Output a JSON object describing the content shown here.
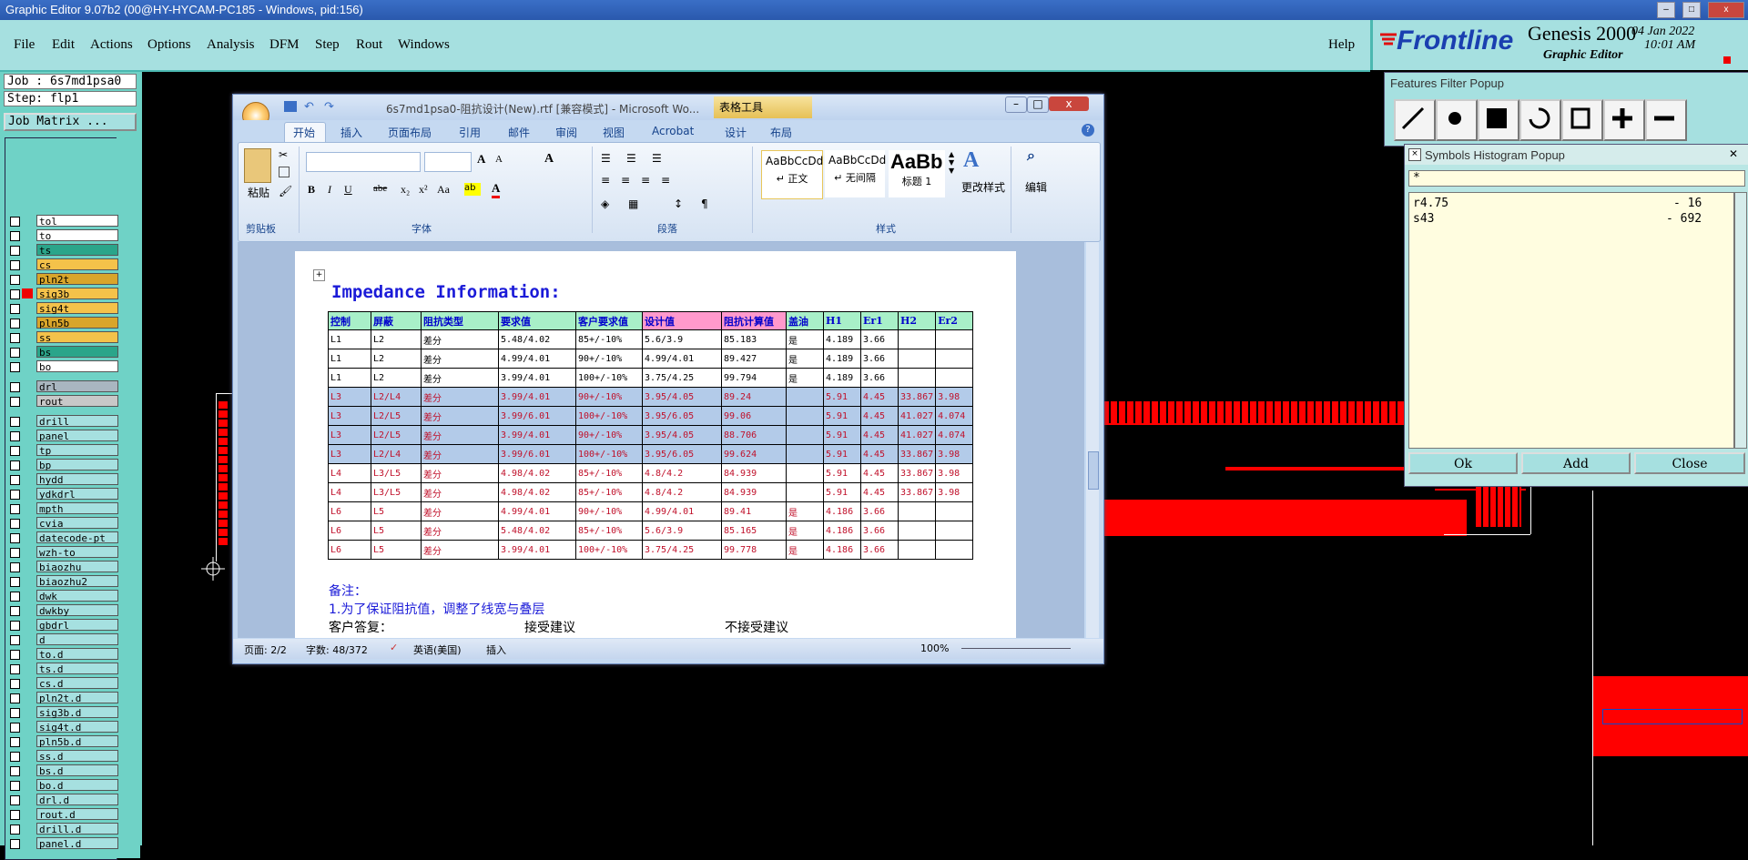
{
  "window": {
    "title": "Graphic Editor 9.07b2 (00@HY-HYCAM-PC185 - Windows, pid:156)"
  },
  "menu": {
    "items": [
      "File",
      "Edit",
      "Actions",
      "Options",
      "Analysis",
      "DFM",
      "Step",
      "Rout",
      "Windows"
    ],
    "help": "Help"
  },
  "brand": {
    "logo": "Frontline",
    "product": "Genesis 2000",
    "subtitle": "Graphic Editor",
    "date": "04 Jan 2022",
    "time": "10:01 AM"
  },
  "left": {
    "job": "Job : 6s7md1psa0",
    "step": "Step: flp1",
    "job_matrix": "Job Matrix ...",
    "layers": [
      {
        "name": "tol",
        "color": "#ffffff"
      },
      {
        "name": "to",
        "color": "#ffffff"
      },
      {
        "name": "ts",
        "color": "#2aa58a"
      },
      {
        "name": "cs",
        "color": "#f4c24a"
      },
      {
        "name": "pln2t",
        "color": "#d9a52a"
      },
      {
        "name": "sig3b",
        "color": "#f4c24a"
      },
      {
        "name": "sig4t",
        "color": "#f4c24a"
      },
      {
        "name": "pln5b",
        "color": "#d9a52a"
      },
      {
        "name": "ss",
        "color": "#f4c24a"
      },
      {
        "name": "bs",
        "color": "#2aa58a"
      },
      {
        "name": "bo",
        "color": "#ffffff"
      }
    ],
    "drill_layers": [
      {
        "name": "drl",
        "color": "#a9b6c0"
      },
      {
        "name": "rout",
        "color": "#c8c8c8"
      }
    ],
    "misc_layers": [
      "drill",
      "panel",
      "tp",
      "bp",
      "hydd",
      "ydkdrl",
      "mpth",
      "cvia",
      "datecode-pt",
      "wzh-to",
      "biaozhu",
      "biaozhu2",
      "dwk",
      "dwkby",
      "gbdrl",
      "d",
      "to.d",
      "ts.d",
      "cs.d",
      "pln2t.d",
      "sig3b.d",
      "sig4t.d",
      "pln5b.d",
      "ss.d",
      "bs.d",
      "bo.d",
      "drl.d",
      "rout.d",
      "drill.d",
      "panel.d"
    ]
  },
  "word": {
    "title": "6s7md1psa0-阻抗设计(New).rtf [兼容模式] - Microsoft Wo...",
    "context_tab": "表格工具",
    "tabs": [
      "开始",
      "插入",
      "页面布局",
      "引用",
      "邮件",
      "审阅",
      "视图",
      "Acrobat",
      "设计",
      "布局"
    ],
    "groups": [
      "剪贴板",
      "字体",
      "段落",
      "样式",
      "编辑"
    ],
    "paste": "粘贴",
    "styles": [
      {
        "preview": "AaBbCcDd",
        "name": "↵ 正文"
      },
      {
        "preview": "AaBbCcDd",
        "name": "↵ 无间隔"
      },
      {
        "preview": "AaBb",
        "name": "标题 1"
      }
    ],
    "change_styles": "更改样式",
    "edit": "编辑",
    "heading": "Impedance Information:",
    "table_headers": [
      "控制",
      "屏蔽",
      "阻抗类型",
      "要求值",
      "客户要求值",
      "设计值",
      "阻抗计算值",
      "盖油",
      "H1",
      "Er1",
      "H2",
      "Er2"
    ],
    "rows": [
      [
        "L1",
        "L2",
        "差分",
        "5.48/4.02",
        "85+/-10%",
        "5.6/3.9",
        "85.183",
        "是",
        "4.189",
        "3.66",
        "",
        ""
      ],
      [
        "L1",
        "L2",
        "差分",
        "4.99/4.01",
        "90+/-10%",
        "4.99/4.01",
        "89.427",
        "是",
        "4.189",
        "3.66",
        "",
        ""
      ],
      [
        "L1",
        "L2",
        "差分",
        "3.99/4.01",
        "100+/-10%",
        "3.75/4.25",
        "99.794",
        "是",
        "4.189",
        "3.66",
        "",
        ""
      ],
      [
        "L3",
        "L2/L4",
        "差分",
        "3.99/4.01",
        "90+/-10%",
        "3.95/4.05",
        "89.24",
        "",
        "5.91",
        "4.45",
        "33.867",
        "3.98"
      ],
      [
        "L3",
        "L2/L5",
        "差分",
        "3.99/6.01",
        "100+/-10%",
        "3.95/6.05",
        "99.06",
        "",
        "5.91",
        "4.45",
        "41.027",
        "4.074"
      ],
      [
        "L3",
        "L2/L5",
        "差分",
        "3.99/4.01",
        "90+/-10%",
        "3.95/4.05",
        "88.706",
        "",
        "5.91",
        "4.45",
        "41.027",
        "4.074"
      ],
      [
        "L3",
        "L2/L4",
        "差分",
        "3.99/6.01",
        "100+/-10%",
        "3.95/6.05",
        "99.624",
        "",
        "5.91",
        "4.45",
        "33.867",
        "3.98"
      ],
      [
        "L4",
        "L3/L5",
        "差分",
        "4.98/4.02",
        "85+/-10%",
        "4.8/4.2",
        "84.939",
        "",
        "5.91",
        "4.45",
        "33.867",
        "3.98"
      ],
      [
        "L4",
        "L3/L5",
        "差分",
        "4.98/4.02",
        "85+/-10%",
        "4.8/4.2",
        "84.939",
        "",
        "5.91",
        "4.45",
        "33.867",
        "3.98"
      ],
      [
        "L6",
        "L5",
        "差分",
        "4.99/4.01",
        "90+/-10%",
        "4.99/4.01",
        "89.41",
        "是",
        "4.186",
        "3.66",
        "",
        ""
      ],
      [
        "L6",
        "L5",
        "差分",
        "5.48/4.02",
        "85+/-10%",
        "5.6/3.9",
        "85.165",
        "是",
        "4.186",
        "3.66",
        "",
        ""
      ],
      [
        "L6",
        "L5",
        "差分",
        "3.99/4.01",
        "100+/-10%",
        "3.75/4.25",
        "99.778",
        "是",
        "4.186",
        "3.66",
        "",
        ""
      ]
    ],
    "note1": "备注：",
    "note2": "1.为了保证阻抗值，调整了线宽与叠层",
    "reply": "客户答复：",
    "accept": "接受建议",
    "reject": "不接受建议",
    "status": {
      "page": "页面: 2/2",
      "words": "字数: 48/372",
      "lang": "英语(美国)",
      "mode": "插入",
      "zoom": "100%"
    }
  },
  "features_popup": {
    "title": "Features Filter Popup"
  },
  "symbols_popup": {
    "title": "Symbols Histogram Popup",
    "filter": "*",
    "items": [
      {
        "name": "r4.75",
        "count": "- 16"
      },
      {
        "name": "s43",
        "count": "- 692"
      }
    ],
    "buttons": [
      "Ok",
      "Add",
      "Close"
    ]
  },
  "colors": {
    "canvas": "#000000",
    "panel": "#a6e0e0",
    "accent": "#ff0000"
  }
}
